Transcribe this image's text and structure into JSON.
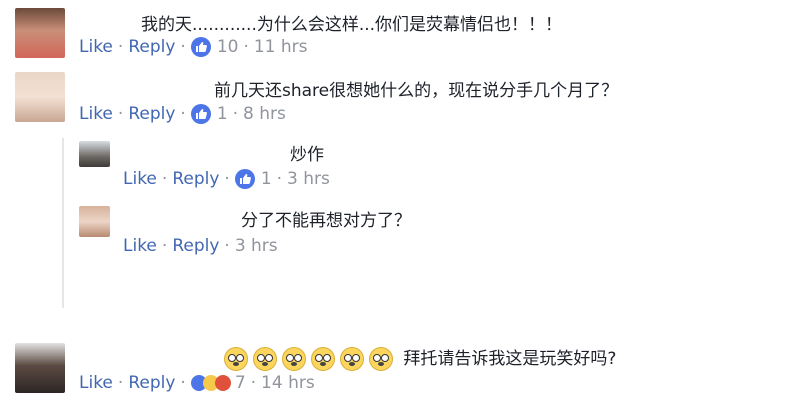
{
  "labels": {
    "like": "Like",
    "reply": "Reply",
    "dot": "·"
  },
  "colors": {
    "link": "#4267b2",
    "meta": "#90949c",
    "text": "#1d2129",
    "like_badge": "#4c75e8"
  },
  "comments": [
    {
      "text": "我的天............为什么会这样...你们是荧幕情侣也！！！",
      "count": "10",
      "time": "11 hrs"
    },
    {
      "text": "前几天还share很想她什么的，现在说分手几个月了？",
      "count": "1",
      "time": "8 hrs"
    },
    {
      "text": "炒作",
      "count": "1",
      "time": "3 hrs"
    },
    {
      "text": "分了不能再想对方了？",
      "time": "3 hrs"
    },
    {
      "emoji_count": 6,
      "emoji_icon": "fearful-face-icon",
      "text": "拜托请告诉我这是玩笑好吗?",
      "count": "7",
      "time": "14 hrs"
    }
  ]
}
